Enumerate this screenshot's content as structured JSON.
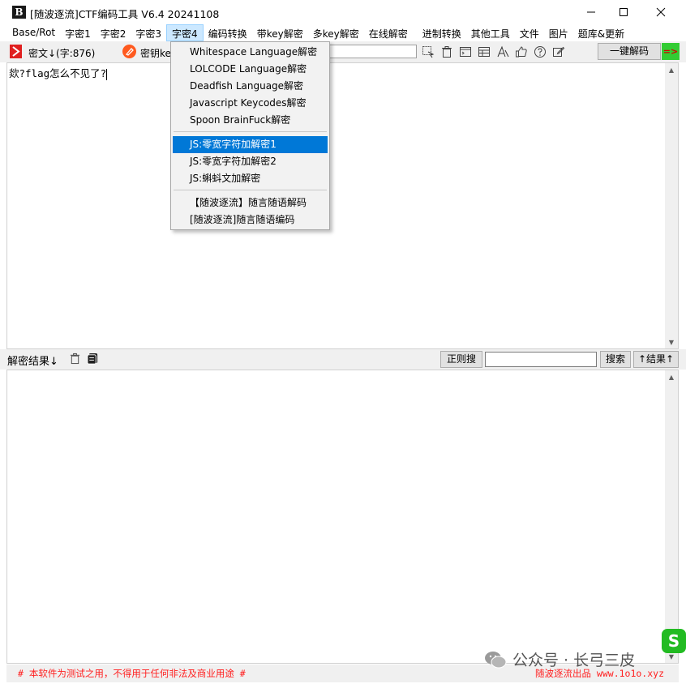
{
  "window": {
    "logo": "B",
    "title": "[随波逐流]CTF编码工具 V6.4 20241108"
  },
  "menubar": [
    {
      "label": "Base/Rot"
    },
    {
      "label": "字密1"
    },
    {
      "label": "字密2"
    },
    {
      "label": "字密3"
    },
    {
      "label": "字密4"
    },
    {
      "label": "编码转换"
    },
    {
      "label": "带key解密"
    },
    {
      "label": "多key解密"
    },
    {
      "label": "在线解密"
    },
    {
      "label": "进制转换"
    },
    {
      "label": "其他工具"
    },
    {
      "label": "文件"
    },
    {
      "label": "图片"
    },
    {
      "label": "题库&更新"
    }
  ],
  "toolbar": {
    "cipher_label": "密文↓(字:876)",
    "key_label": "密钥ke",
    "decode_button": "一键解码",
    "arrow_button": "=>"
  },
  "input": {
    "text": "欻?flag怎么不见了?"
  },
  "result_bar": {
    "label": "解密结果↓",
    "regex_button": "正则搜",
    "search_value": "",
    "search_button": "搜索",
    "up_button": "↑结果↑"
  },
  "dropdown": {
    "groups": [
      [
        "Whitespace Language解密",
        "LOLCODE Language解密",
        "Deadfish Language解密",
        "Javascript Keycodes解密",
        "Spoon BrainFuck解密"
      ],
      [
        "JS:零宽字符加解密1",
        "JS:零宽字符加解密2",
        "JS:蝌蚪文加解密"
      ],
      [
        "【随波逐流】随言随语解码",
        "[随波逐流]随言随语编码"
      ]
    ],
    "selected": "JS:零宽字符加解密1"
  },
  "footer": {
    "left": "# 本软件为测试之用，不得用于任何非法及商业用途 #",
    "right": "随波逐流出品 www.1o1o.xyz"
  },
  "watermark": {
    "text": "公众号 · 长弓三皮"
  },
  "badge": {
    "label": "S"
  },
  "colors": {
    "accent": "#0078d7",
    "footer_red": "#ff2020",
    "menu_hover": "#cce8ff",
    "green": "#33cc33"
  }
}
